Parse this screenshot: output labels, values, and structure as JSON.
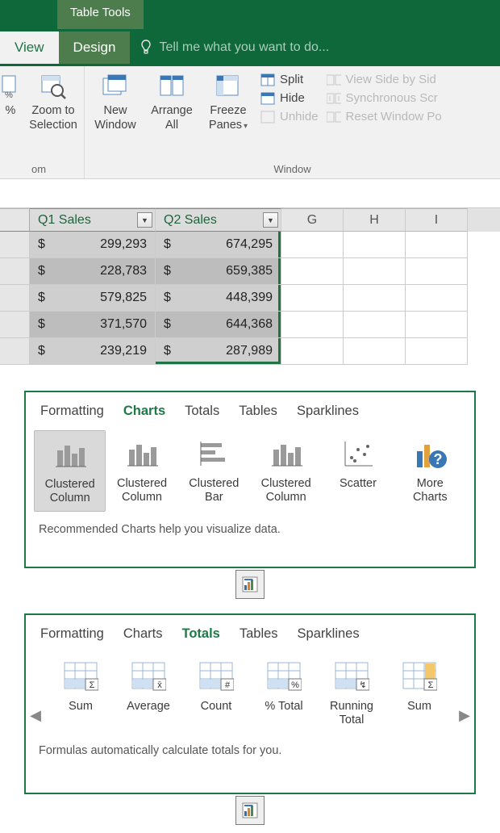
{
  "title_tabs": {
    "contextual_group": "Table Tools",
    "contextual_tab": "Design",
    "main_tab": "View"
  },
  "tellme": {
    "placeholder": "Tell me what you want to do..."
  },
  "ribbon": {
    "zoom": {
      "zoom_to_selection_l1": "Zoom to",
      "zoom_to_selection_l2": "Selection",
      "group_label_suffix": "om"
    },
    "window": {
      "new_window_l1": "New",
      "new_window_l2": "Window",
      "arrange_l1": "Arrange",
      "arrange_l2": "All",
      "freeze_l1": "Freeze",
      "freeze_l2": "Panes",
      "split": "Split",
      "hide": "Hide",
      "unhide": "Unhide",
      "view_side": "View Side by Sid",
      "sync_scroll": "Synchronous Scr",
      "reset_pos": "Reset Window Po",
      "group_label": "Window"
    }
  },
  "table": {
    "headers": [
      "Q1 Sales",
      "Q2 Sales"
    ],
    "col_letters": [
      "G",
      "H",
      "I"
    ],
    "rows": [
      {
        "q1": "299,293",
        "q2": "674,295"
      },
      {
        "q1": "228,783",
        "q2": "659,385"
      },
      {
        "q1": "579,825",
        "q2": "448,399"
      },
      {
        "q1": "371,570",
        "q2": "644,368"
      },
      {
        "q1": "239,219",
        "q2": "287,989"
      }
    ],
    "currency": "$"
  },
  "qa_tabs": {
    "formatting": "Formatting",
    "charts": "Charts",
    "totals": "Totals",
    "tables": "Tables",
    "sparklines": "Sparklines"
  },
  "qa1": {
    "items": [
      {
        "label_l1": "Clustered",
        "label_l2": "Column"
      },
      {
        "label_l1": "Clustered",
        "label_l2": "Column"
      },
      {
        "label_l1": "Clustered",
        "label_l2": "Bar"
      },
      {
        "label_l1": "Clustered",
        "label_l2": "Column"
      },
      {
        "label_l1": "Scatter",
        "label_l2": ""
      },
      {
        "label_l1": "More",
        "label_l2": "Charts"
      }
    ],
    "description": "Recommended Charts help you visualize data."
  },
  "qa2": {
    "items": [
      {
        "label_l1": "Sum",
        "label_l2": ""
      },
      {
        "label_l1": "Average",
        "label_l2": ""
      },
      {
        "label_l1": "Count",
        "label_l2": ""
      },
      {
        "label_l1": "% Total",
        "label_l2": ""
      },
      {
        "label_l1": "Running",
        "label_l2": "Total"
      },
      {
        "label_l1": "Sum",
        "label_l2": ""
      }
    ],
    "description": "Formulas automatically calculate totals for you."
  }
}
